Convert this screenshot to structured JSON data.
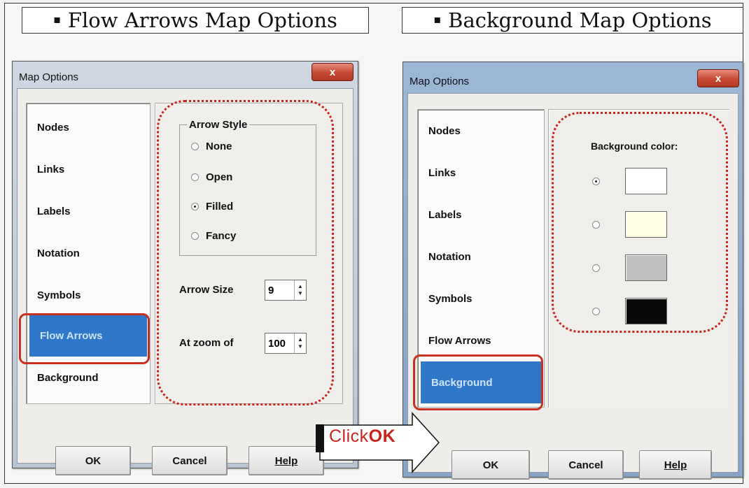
{
  "headings": {
    "left": "Flow Arrows Map Options",
    "right": "Background Map Options",
    "bullet": "▪"
  },
  "left_dialog": {
    "title": "Map Options",
    "close_label": "x",
    "nav_items": [
      "Nodes",
      "Links",
      "Labels",
      "Notation",
      "Symbols",
      "Flow Arrows",
      "Background"
    ],
    "selected_nav": "Flow Arrows",
    "arrow_style": {
      "label": "Arrow Style",
      "options": [
        "None",
        "Open",
        "Filled",
        "Fancy"
      ],
      "selected": "Filled"
    },
    "arrow_size": {
      "label": "Arrow Size",
      "value": "9"
    },
    "zoom": {
      "label": "At zoom of",
      "value": "100"
    },
    "buttons": {
      "ok": "OK",
      "cancel": "Cancel",
      "help": "Help"
    }
  },
  "right_dialog": {
    "title": "Map Options",
    "close_label": "x",
    "nav_items": [
      "Nodes",
      "Links",
      "Labels",
      "Notation",
      "Symbols",
      "Flow Arrows",
      "Background"
    ],
    "selected_nav": "Background",
    "background_color": {
      "label": "Background color:",
      "swatches": [
        "#ffffff",
        "#ffffe6",
        "#c0c0c0",
        "#0a0a0a"
      ],
      "selected_index": 0
    },
    "buttons": {
      "ok": "OK",
      "cancel": "Cancel",
      "help": "Help"
    }
  },
  "callout": {
    "click": "Click",
    "ok": "OK"
  },
  "colors": {
    "highlight": "#c8241e",
    "selection": "#2f78c9"
  }
}
